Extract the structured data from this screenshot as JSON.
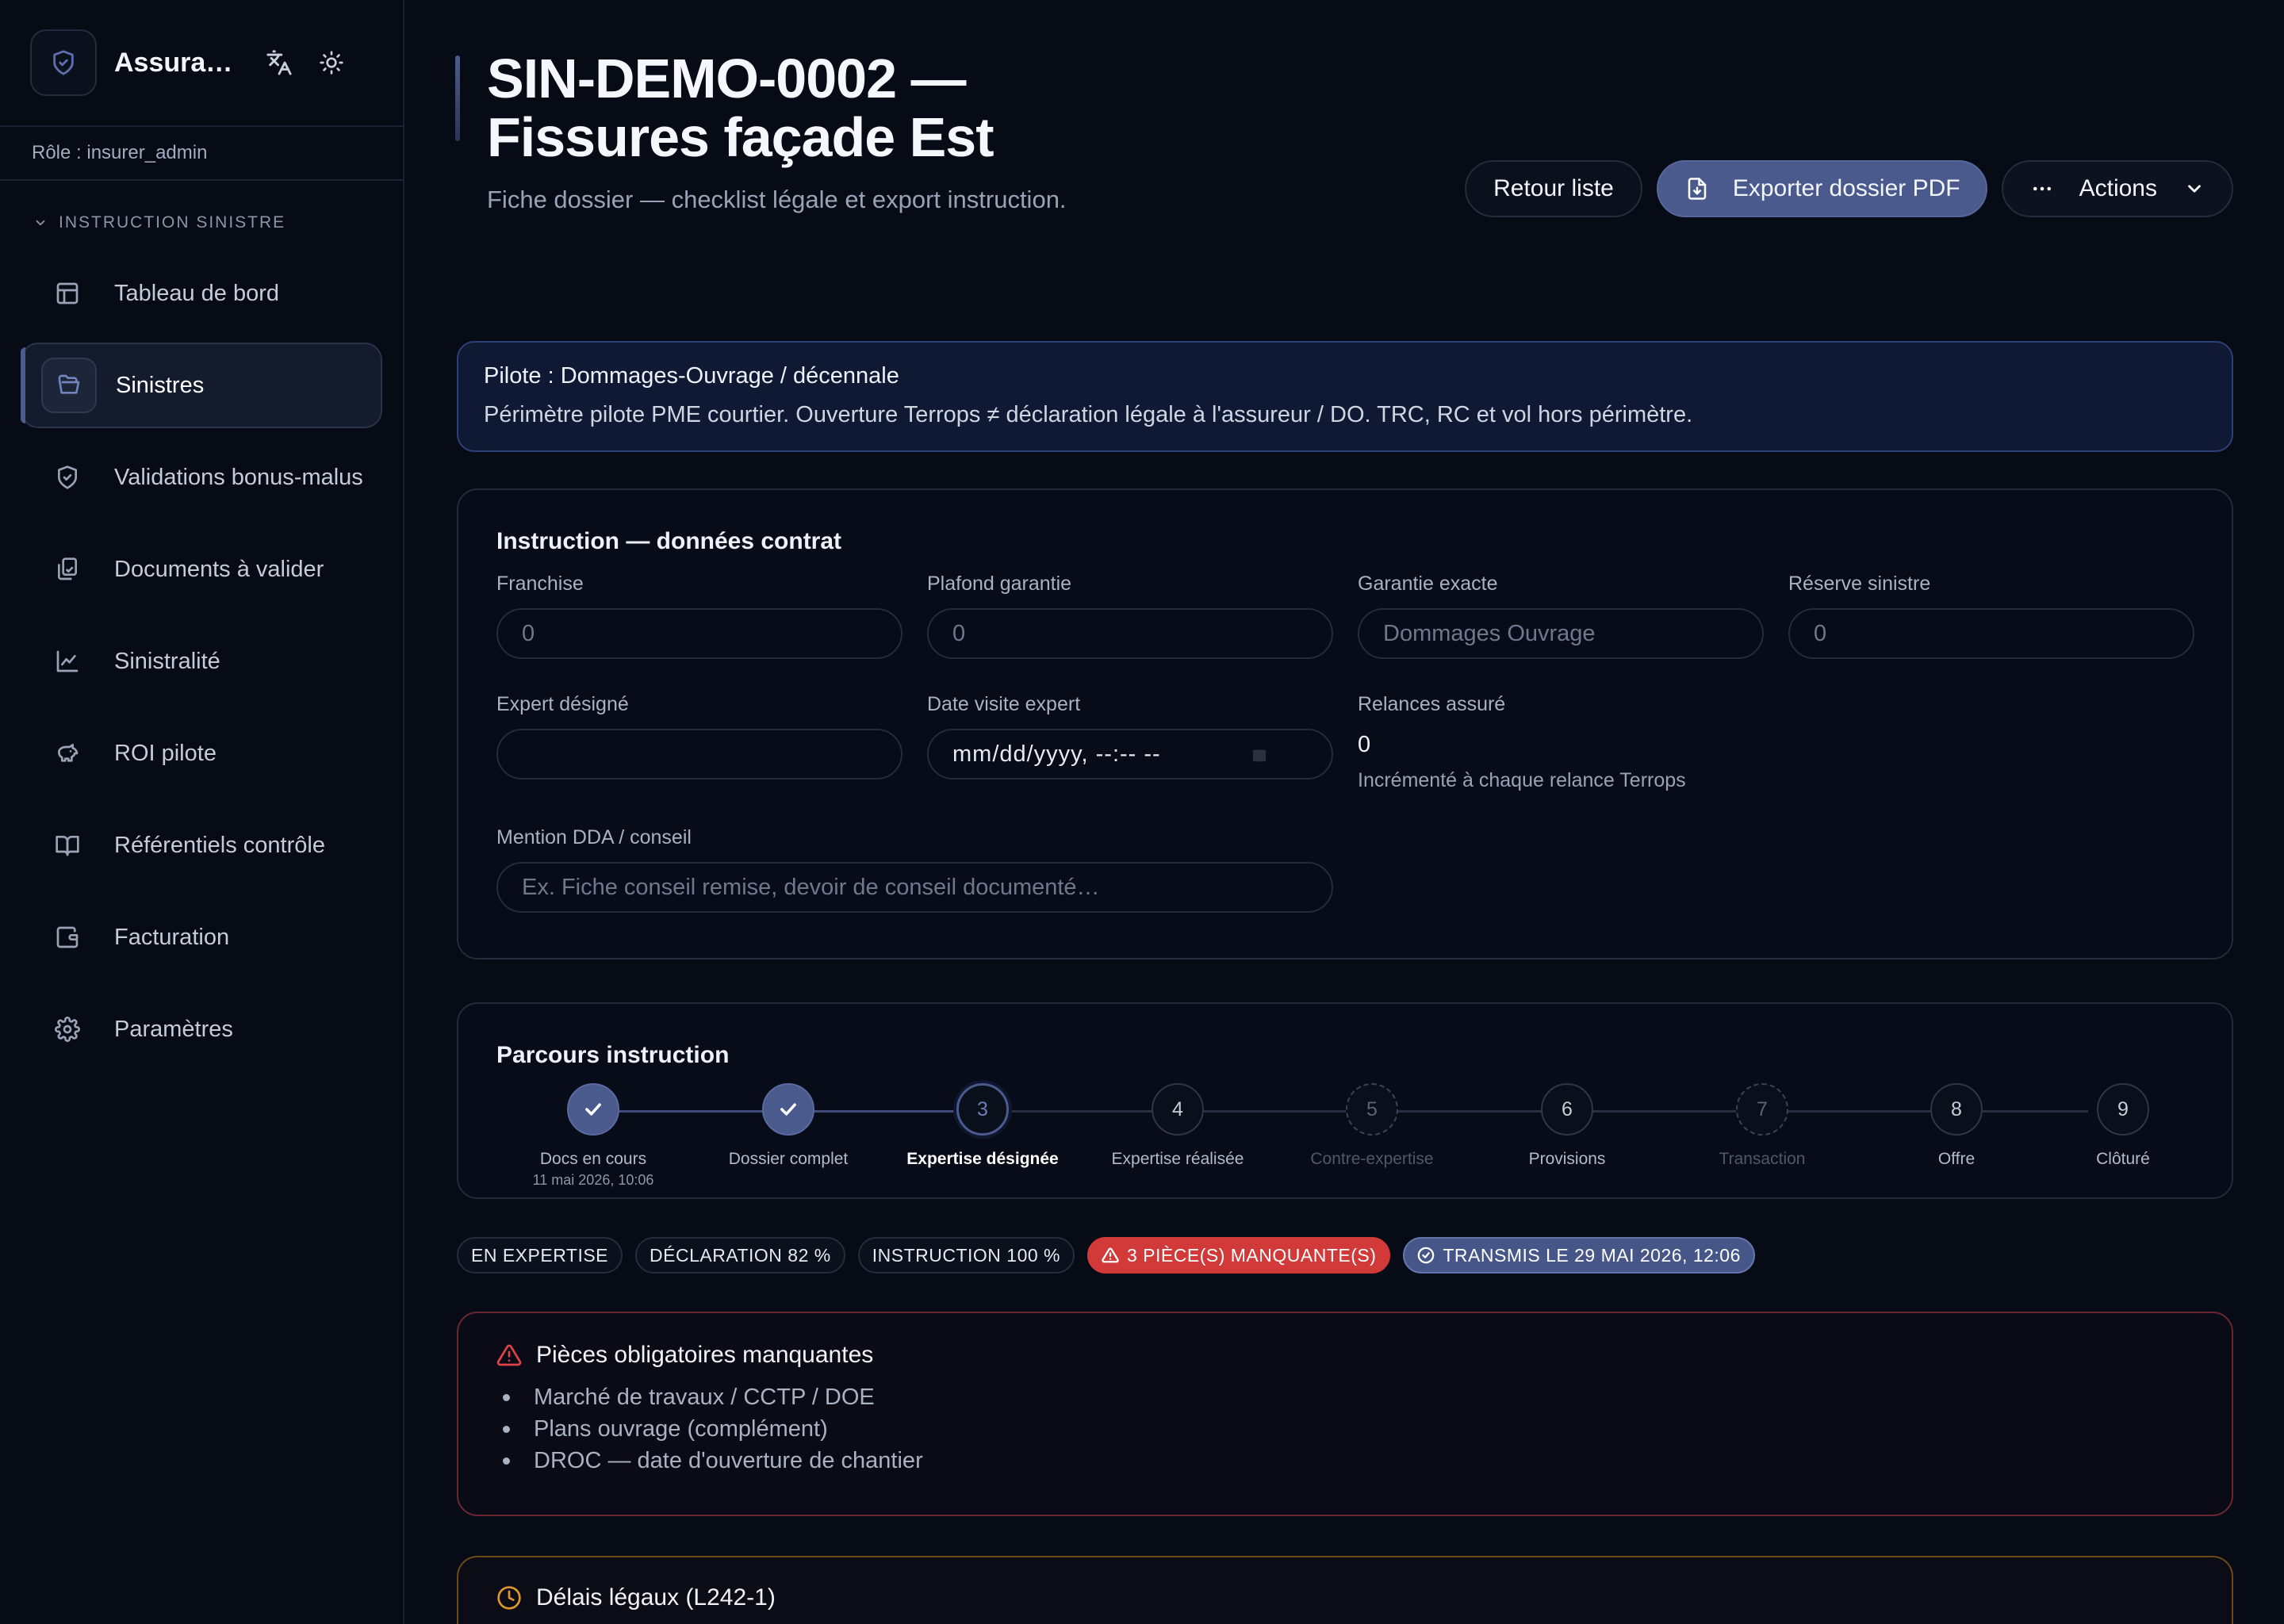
{
  "app": {
    "name": "Assurance Terrops"
  },
  "sidebar": {
    "role": "Rôle : insurer_admin",
    "section": "INSTRUCTION SINISTRE",
    "items": [
      {
        "label": "Tableau de bord",
        "icon": "layout-icon"
      },
      {
        "label": "Sinistres",
        "icon": "folder-open-icon",
        "active": true
      },
      {
        "label": "Validations bonus-malus",
        "icon": "shield-icon"
      },
      {
        "label": "Documents à valider",
        "icon": "documents-icon"
      },
      {
        "label": "Sinistralité",
        "icon": "chart-line-icon"
      },
      {
        "label": "ROI pilote",
        "icon": "piggy-bank-icon"
      },
      {
        "label": "Référentiels contrôle",
        "icon": "book-open-icon"
      },
      {
        "label": "Facturation",
        "icon": "wallet-icon"
      },
      {
        "label": "Paramètres",
        "icon": "gear-icon"
      }
    ]
  },
  "header": {
    "title_line1": "SIN-DEMO-0002 —",
    "title_line2": "Fissures façade Est",
    "subtitle": "Fiche dossier — checklist légale et export instruction.",
    "back_label": "Retour liste",
    "export_label": "Exporter dossier PDF",
    "actions_label": "Actions"
  },
  "pilot": {
    "line1": "Pilote : Dommages-Ouvrage / décennale",
    "line2": "Périmètre pilote PME courtier. Ouverture Terrops ≠ déclaration légale à l'assureur / DO. TRC, RC et vol hors périmètre."
  },
  "contract": {
    "title": "Instruction — données contrat",
    "franchise": {
      "label": "Franchise",
      "placeholder": "0"
    },
    "plafond": {
      "label": "Plafond garantie",
      "placeholder": "0"
    },
    "garantie": {
      "label": "Garantie exacte",
      "placeholder": "Dommages Ouvrage"
    },
    "reserve": {
      "label": "Réserve sinistre",
      "placeholder": "0"
    },
    "expert": {
      "label": "Expert désigné",
      "value": ""
    },
    "date_visite": {
      "label": "Date visite expert",
      "value": "mm/dd/yyyy, --:-- --"
    },
    "relances": {
      "label": "Relances assuré",
      "value": "0",
      "hint": "Incrémenté à chaque relance Terrops"
    },
    "mention": {
      "label": "Mention DDA / conseil",
      "placeholder": "Ex. Fiche conseil remise, devoir de conseil documenté…"
    }
  },
  "parcours": {
    "title": "Parcours instruction",
    "steps": [
      {
        "num": "1",
        "label": "Docs en cours",
        "date": "11 mai 2026, 10:06",
        "state": "done"
      },
      {
        "num": "2",
        "label": "Dossier complet",
        "date": "",
        "state": "done"
      },
      {
        "num": "3",
        "label": "Expertise désignée",
        "date": "",
        "state": "current"
      },
      {
        "num": "4",
        "label": "Expertise réalisée",
        "date": "",
        "state": "todo"
      },
      {
        "num": "5",
        "label": "Contre-expertise",
        "date": "",
        "state": "optional"
      },
      {
        "num": "6",
        "label": "Provisions",
        "date": "",
        "state": "todo"
      },
      {
        "num": "7",
        "label": "Transaction",
        "date": "",
        "state": "optional"
      },
      {
        "num": "8",
        "label": "Offre",
        "date": "",
        "state": "todo"
      },
      {
        "num": "9",
        "label": "Clôturé",
        "date": "",
        "state": "todo"
      }
    ]
  },
  "badges": {
    "status": "EN EXPERTISE",
    "declaration": "DÉCLARATION 82 %",
    "instruction": "INSTRUCTION 100 %",
    "missing": "3 PIÈCE(S) MANQUANTE(S)",
    "transmitted": "TRANSMIS LE 29 MAI 2026, 12:06"
  },
  "missing": {
    "title": "Pièces obligatoires manquantes",
    "items": [
      "Marché de travaux / CCTP / DOE",
      "Plans ouvrage (complément)",
      "DROC — date d'ouverture de chantier"
    ]
  },
  "delais": {
    "title": "Délais légaux (L242-1)"
  },
  "colors": {
    "accent": "#4b5a8d",
    "danger": "#d23a3a",
    "warning": "#e0982a",
    "background": "#070b16"
  }
}
